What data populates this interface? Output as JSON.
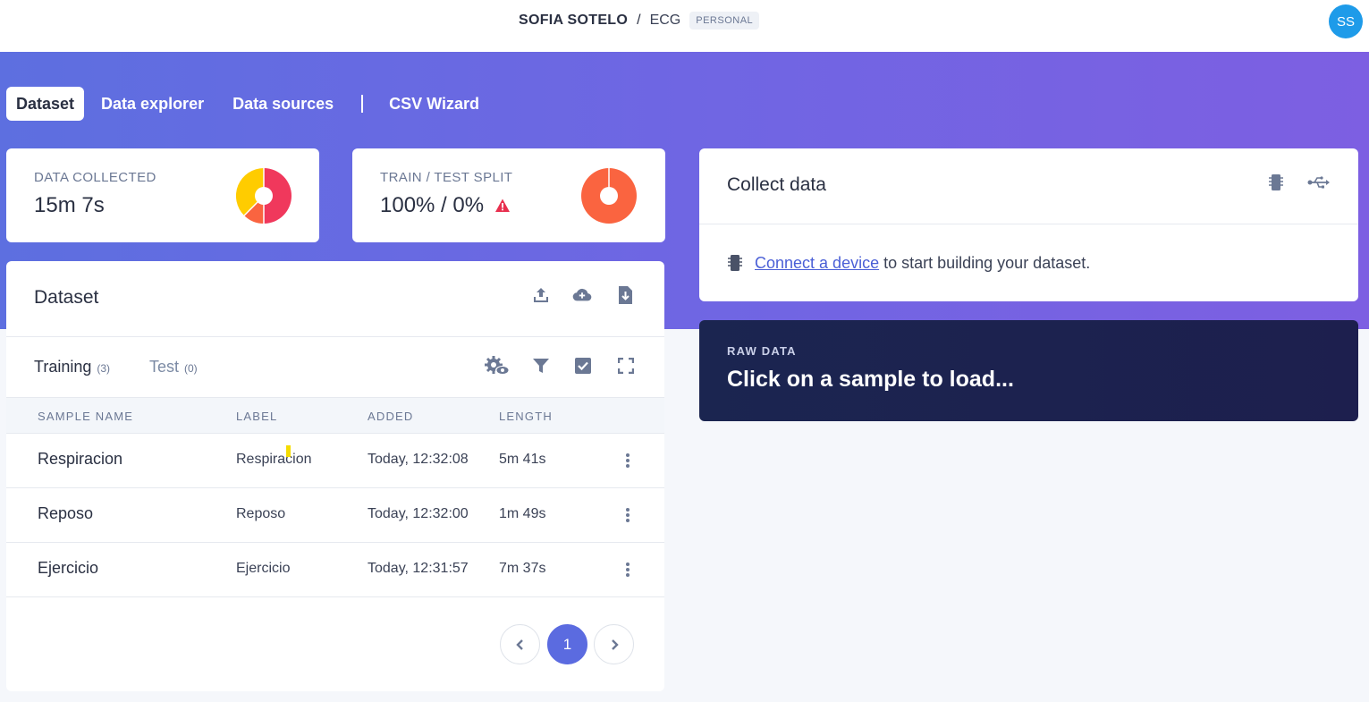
{
  "header": {
    "owner": "SOFIA SOTELO",
    "separator": "/",
    "project": "ECG",
    "badge": "PERSONAL",
    "avatar_initials": "SS"
  },
  "nav": {
    "tabs": [
      {
        "label": "Dataset",
        "active": true
      },
      {
        "label": "Data explorer",
        "active": false
      },
      {
        "label": "Data sources",
        "active": false
      },
      {
        "label": "CSV Wizard",
        "active": false
      }
    ]
  },
  "stats": {
    "data_collected": {
      "label": "DATA COLLECTED",
      "value": "15m 7s"
    },
    "train_test_split": {
      "label": "TRAIN / TEST SPLIT",
      "value": "100% / 0%",
      "warning_icon": "warning-triangle-icon"
    }
  },
  "dataset": {
    "title": "Dataset",
    "tabs": [
      {
        "label": "Training",
        "count": "(3)"
      },
      {
        "label": "Test",
        "count": "(0)"
      }
    ],
    "columns": [
      "SAMPLE NAME",
      "LABEL",
      "ADDED",
      "LENGTH"
    ],
    "rows": [
      {
        "name": "Respiracion",
        "label": "Respiracion",
        "added": "Today, 12:32:08",
        "length": "5m 41s"
      },
      {
        "name": "Reposo",
        "label": "Reposo",
        "added": "Today, 12:32:00",
        "length": "1m 49s"
      },
      {
        "name": "Ejercicio",
        "label": "Ejercicio",
        "added": "Today, 12:31:57",
        "length": "7m 37s"
      }
    ],
    "pagination": {
      "current": "1"
    }
  },
  "collect": {
    "title": "Collect data",
    "link_text": "Connect a device",
    "rest_text": " to start building your dataset."
  },
  "raw": {
    "label": "RAW DATA",
    "title": "Click on a sample to load..."
  },
  "colors": {
    "accent": "#5b6be0",
    "pie_red": "#f0385c",
    "pie_yellow": "#ffcc00",
    "pie_orange": "#fa6440",
    "warning": "#e8304f"
  }
}
